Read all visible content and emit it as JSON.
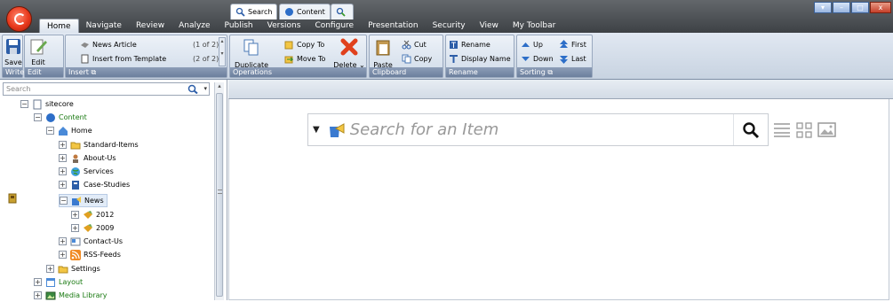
{
  "tabs": [
    "Home",
    "Navigate",
    "Review",
    "Analyze",
    "Publish",
    "Versions",
    "Configure",
    "Presentation",
    "Security",
    "View",
    "My Toolbar"
  ],
  "window_buttons": [
    "▾",
    "–",
    "□",
    "x"
  ],
  "ribbon": {
    "write": {
      "label": "Write",
      "save": "Save"
    },
    "edit": {
      "label": "Edit",
      "edit": "Edit"
    },
    "insert": {
      "label": "Insert",
      "items": [
        {
          "label": "News Article",
          "count": "(1 of 2)"
        },
        {
          "label": "Insert from Template",
          "count": "(2 of 2)"
        }
      ]
    },
    "operations": {
      "label": "Operations",
      "duplicate": "Duplicate",
      "copy_to": "Copy To",
      "move_to": "Move To",
      "delete": "Delete"
    },
    "clipboard": {
      "label": "Clipboard",
      "paste": "Paste",
      "cut": "Cut",
      "copy": "Copy"
    },
    "rename": {
      "label": "Rename",
      "rename": "Rename",
      "display_name": "Display Name"
    },
    "sorting": {
      "label": "Sorting",
      "up": "Up",
      "down": "Down",
      "first": "First",
      "last": "Last"
    }
  },
  "left_search": {
    "placeholder": "Search"
  },
  "tree": [
    "sitecore",
    "Content",
    "Home",
    "Standard-Items",
    "About-Us",
    "Services",
    "Case-Studies",
    "News",
    "2012",
    "2009",
    "Contact-Us",
    "RSS-Feeds",
    "Settings",
    "Layout",
    "Media Library"
  ],
  "editor_tabs": [
    "Search",
    "Content"
  ],
  "search": {
    "placeholder": "Search for an Item"
  },
  "colors": {
    "title_bg": "#4f5357",
    "ribbon_bg": "#d5dfeb",
    "label_bg": "#7a8daa",
    "tree_green": "#1a7a12"
  }
}
